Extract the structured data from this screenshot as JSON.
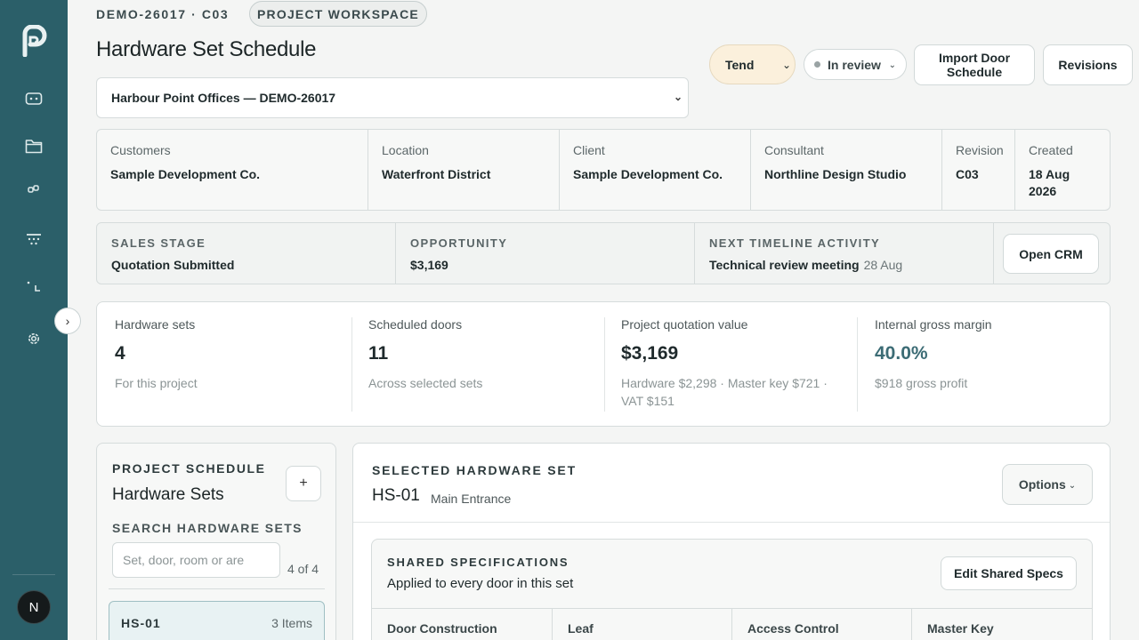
{
  "sidebar": {
    "nav_icons": [
      "dashboard-icon",
      "folder-icon",
      "link-icon",
      "filter-icon",
      "corner-icon",
      "settings-icon"
    ],
    "avatar_initial": "N",
    "collapse_glyph": "›"
  },
  "header": {
    "code": "DEMO-26017 · C03",
    "workspace_label": "PROJECT WORKSPACE",
    "title": "Hardware Set Schedule",
    "project_selected": "Harbour Point Offices — DEMO-26017"
  },
  "actions": {
    "tend_label": "Tend",
    "review_label": "In review",
    "import_label_line1": "Import Door",
    "import_label_line2": "Schedule",
    "revisions_label": "Revisions"
  },
  "info": [
    {
      "label": "Customers",
      "value": "Sample Development Co."
    },
    {
      "label": "Location",
      "value": "Waterfront District"
    },
    {
      "label": "Client",
      "value": "Sample Development Co."
    },
    {
      "label": "Consultant",
      "value": "Northline Design Studio"
    },
    {
      "label": "Revision",
      "value": "C03"
    },
    {
      "label": "Created",
      "value_line1": "18 Aug",
      "value_line2": "2026"
    }
  ],
  "sales": {
    "stage_label": "SALES STAGE",
    "stage_value": "Quotation Submitted",
    "opportunity_label": "OPPORTUNITY",
    "opportunity_value": "$3,169",
    "timeline_label": "NEXT TIMELINE ACTIVITY",
    "timeline_value": "Technical review meeting",
    "timeline_date": "28 Aug",
    "open_crm_label": "Open CRM"
  },
  "stats": [
    {
      "label": "Hardware sets",
      "value": "4",
      "sub": "For this project"
    },
    {
      "label": "Scheduled doors",
      "value": "11",
      "sub": "Across selected sets"
    },
    {
      "label": "Project quotation value",
      "value": "$3,169",
      "sub_line1": "Hardware $2,298 · Master key $721 ·",
      "sub_line2": "VAT $151"
    },
    {
      "label": "Internal gross margin",
      "value": "40.0%",
      "sub": "$918 gross profit"
    }
  ],
  "schedule": {
    "caption": "PROJECT SCHEDULE",
    "title": "Hardware Sets",
    "add_glyph": "+",
    "search_caption": "SEARCH HARDWARE SETS",
    "search_placeholder": "Set, door, room or are",
    "count": "4 of 4",
    "items": [
      {
        "code": "HS-01",
        "items": "3 Items"
      }
    ]
  },
  "selected": {
    "caption": "SELECTED HARDWARE SET",
    "code": "HS-01",
    "name": "Main Entrance",
    "options_label": "Options"
  },
  "shared_specs": {
    "caption": "SHARED SPECIFICATIONS",
    "subtitle": "Applied to every door in this set",
    "edit_label": "Edit Shared Specs",
    "columns": [
      "Door Construction",
      "Leaf",
      "Access Control",
      "Master Key"
    ]
  },
  "colors": {
    "sidebar": "#2b5f69",
    "accent": "#3c6c75",
    "tend_bg": "#fbf0dc",
    "selected_item_bg": "#e8f2f3"
  }
}
